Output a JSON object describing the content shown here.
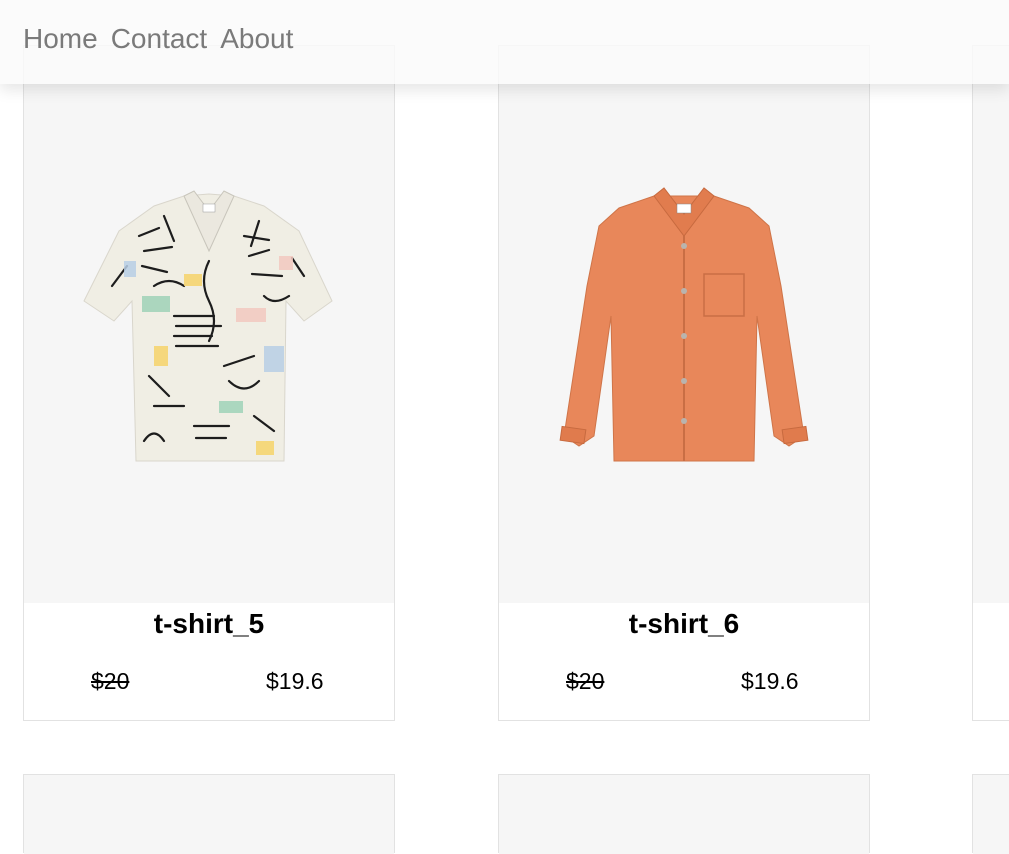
{
  "nav": {
    "links": [
      "Home",
      "Contact",
      "About"
    ]
  },
  "products": [
    {
      "name": "t-shirt_5",
      "old_price": "$20",
      "new_price": "$19.6",
      "image": "patterned-short-sleeve-shirt"
    },
    {
      "name": "t-shirt_6",
      "old_price": "$20",
      "new_price": "$19.6",
      "image": "orange-long-sleeve-shirt"
    }
  ],
  "colors": {
    "nav_text": "#7a7a7a",
    "card_border": "#e2e2e2",
    "image_bg": "#f6f6f6",
    "orange_shirt": "#e8875a"
  }
}
